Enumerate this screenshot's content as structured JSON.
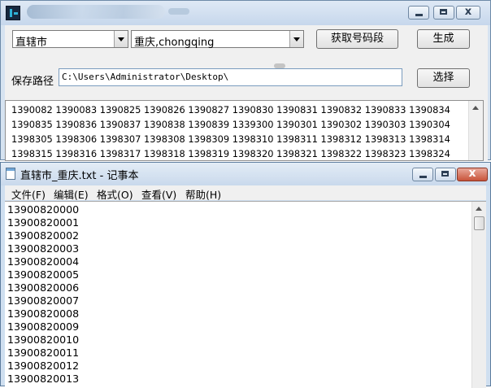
{
  "generator": {
    "province_select": "直辖市",
    "city_select": "重庆,chongqing",
    "fetch_button": "获取号码段",
    "generate_button": "生成",
    "save_path_label": "保存路径",
    "save_path_value": "C:\\Users\\Administrator\\Desktop\\",
    "choose_button": "选择",
    "output_lines": [
      "1390082 1390083 1390825 1390826 1390827 1390830 1390831 1390832 1390833 1390834",
      "1390835 1390836 1390837 1390838 1390839 1339300 1390301 1390302 1390303 1390304",
      "1398305 1398306 1398307 1398308 1398309 1398310 1398311 1398312 1398313 1398314",
      "1398315 1398316 1398317 1398318 1398319 1398320 1398321 1398322 1398323 1398324"
    ]
  },
  "notepad": {
    "title": "直辖市_重庆.txt - 记事本",
    "menus": [
      "文件(F)",
      "编辑(E)",
      "格式(O)",
      "查看(V)",
      "帮助(H)"
    ],
    "lines": [
      "13900820000",
      "13900820001",
      "13900820002",
      "13900820003",
      "13900820004",
      "13900820005",
      "13900820006",
      "13900820007",
      "13900820008",
      "13900820009",
      "13900820010",
      "13900820011",
      "13900820012",
      "13900820013"
    ]
  },
  "caption_buttons": {
    "close": "x"
  },
  "icons": [
    "app-icon",
    "notepad-icon",
    "minimize-icon",
    "maximize-icon",
    "close-icon",
    "dropdown-arrow-icon",
    "scroll-up-icon"
  ]
}
